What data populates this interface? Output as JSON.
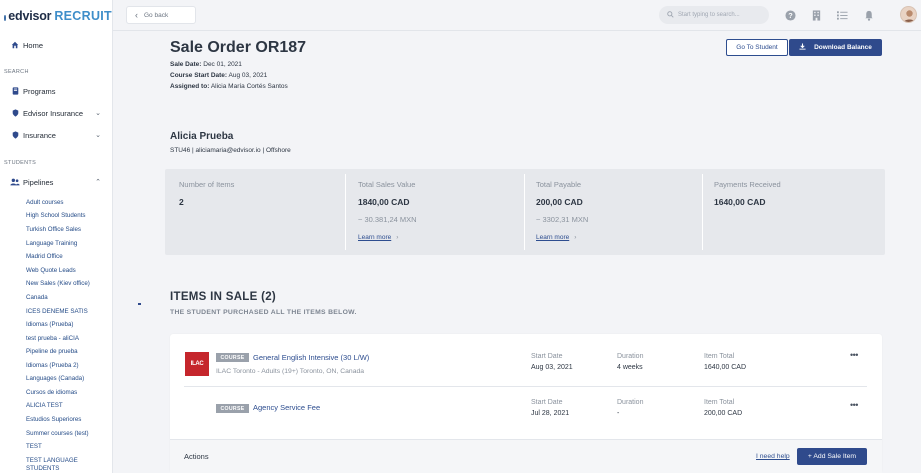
{
  "app": {
    "logo_left": "edvisor",
    "logo_right": "RECRUIT"
  },
  "sidebar": {
    "home": "Home",
    "search_section": "SEARCH",
    "programs": "Programs",
    "edvisor_insurance": "Edvisor Insurance",
    "insurance": "Insurance",
    "students_section": "STUDENTS",
    "pipelines": "Pipelines",
    "pipeline_items": [
      "Adult courses",
      "High School Students",
      "Turkish Office Sales",
      "Language Training",
      "Madrid Office",
      "Web Quote Leads",
      "New Sales (Kiev office)",
      "Canada",
      "ICES DENEME SATIS",
      "Idiomas (Prueba)",
      "test prueba - aliCIA",
      "Pipeline de prueba",
      "Idiomas (Prueba 2)",
      "Languages (Canada)",
      "Cursos de idiomas",
      "ALICIA TEST",
      "Estudios Superiores",
      "Summer courses (test)",
      "TEST",
      "TEST LANGUAGE STUDENTS"
    ]
  },
  "topbar": {
    "go_back": "Go back",
    "search_placeholder": "Start typing to search..."
  },
  "order": {
    "title": "Sale Order OR187",
    "sale_date_label": "Sale Date:",
    "sale_date": "Dec 01, 2021",
    "course_start_label": "Course Start Date:",
    "course_start": "Aug 03, 2021",
    "assigned_label": "Assigned to:",
    "assigned": "Alicia María Cortés Santos",
    "go_to_student": "Go To Student",
    "download_balance": "Download Balance"
  },
  "student": {
    "name": "Alicia Prueba",
    "details": "STU46 | aliciamaria@edvisor.io | Offshore"
  },
  "stats": [
    {
      "label": "Number of Items",
      "value": "2"
    },
    {
      "label": "Total Sales Value",
      "value": "1840,00 CAD",
      "converted": "~ 30.381,24 MXN",
      "link": "Learn more"
    },
    {
      "label": "Total Payable",
      "value": "200,00 CAD",
      "converted": "~ 3302,31 MXN",
      "link": "Learn more"
    },
    {
      "label": "Payments Received",
      "value": "1640,00 CAD"
    }
  ],
  "items_section": {
    "title": "ITEMS IN SALE (2)",
    "subtitle": "THE STUDENT PURCHASED ALL THE ITEMS BELOW."
  },
  "items": [
    {
      "provider_logo": "ILAC",
      "tag": "COURSE",
      "name": "General English Intensive (30 L/W)",
      "sub": "ILAC Toronto - Adults (19+)   Toronto, ON, Canada",
      "start_label": "Start Date",
      "start": "Aug 03, 2021",
      "duration_label": "Duration",
      "duration": "4 weeks",
      "total_label": "Item Total",
      "total": "1640,00 CAD"
    },
    {
      "tag": "COURSE",
      "name": "Agency Service Fee",
      "start_label": "Start Date",
      "start": "Jul 28, 2021",
      "duration_label": "Duration",
      "duration": "-",
      "total_label": "Item Total",
      "total": "200,00 CAD"
    }
  ],
  "actions": {
    "label": "Actions",
    "need_help": "I need help",
    "add_sale_item": "+ Add Sale Item"
  },
  "colors": {
    "primary": "#2f4a8c",
    "link": "#2d4d8f",
    "ilac_red": "#c5262c"
  },
  "icons": [
    "home-icon",
    "programs-icon",
    "shield-icon",
    "users-icon",
    "search-icon",
    "help-icon",
    "building-icon",
    "checklist-icon",
    "bell-icon",
    "download-icon",
    "chevron-right-icon",
    "more-icon"
  ]
}
